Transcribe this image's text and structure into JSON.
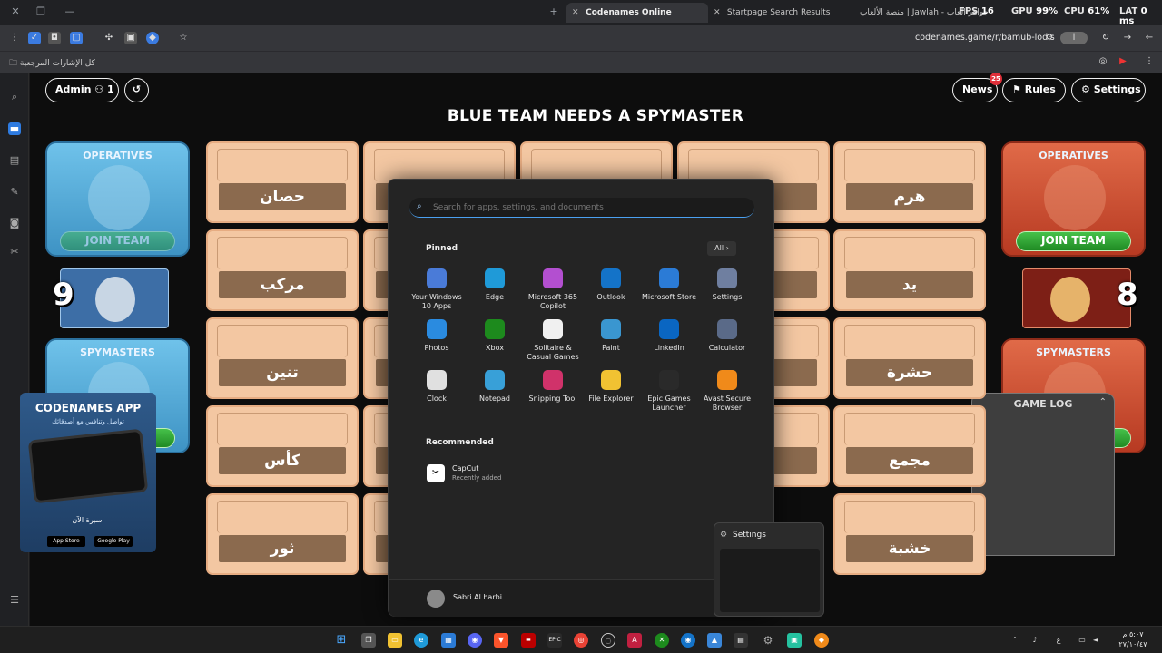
{
  "browser": {
    "tabs": [
      {
        "label": "Codenames Online",
        "active": true
      },
      {
        "label": "Startpage Search Results",
        "active": false
      },
      {
        "label": "جواهر العاب - Jawlah | منصة الألعاب الت...",
        "active": false
      }
    ],
    "perf": {
      "fps_label": "FPS",
      "fps_value": "16",
      "gpu_label": "GPU",
      "gpu_value": "99%",
      "cpu_label": "CPU",
      "cpu_value": "61%",
      "lat_label": "LAT",
      "lat_value": "0 ms"
    },
    "url": "codenames.game/r/bamub-lodis",
    "bookmarks_label": "كل الإشارات المرجعية"
  },
  "game": {
    "admin_label": "Admin",
    "player_count": "1",
    "banner": "BLUE TEAM NEEDS A SPYMASTER",
    "news_label": "News",
    "news_badge": "25",
    "rules_label": "Rules",
    "settings_label": "Settings",
    "blue": {
      "operatives_title": "OPERATIVES",
      "spymasters_title": "SPYMASTERS",
      "join_label": "JOIN TEAM",
      "score": "9"
    },
    "red": {
      "operatives_title": "OPERATIVES",
      "spymasters_title": "SPYMASTERS",
      "join_label": "JOIN TEAM",
      "score": "8"
    },
    "cards_left": [
      "حصان",
      "مركب",
      "تنين",
      "كأس",
      "ثور"
    ],
    "cards_right": [
      "هرم",
      "يد",
      "حشرة",
      "مجمع",
      "خشبة"
    ],
    "game_log_title": "GAME LOG",
    "app_promo": {
      "title": "CODENAMES APP",
      "subtitle": "تواصل وتنافس مع أصدقائك",
      "cta": "اسبرة الآن",
      "store1": "App Store",
      "store2": "Google Play"
    }
  },
  "start_menu": {
    "search_placeholder": "Search for apps, settings, and documents",
    "pinned_title": "Pinned",
    "all_label": "All",
    "pinned": [
      {
        "label": "Your Windows 10 Apps",
        "icon": "windows-apps-icon",
        "color": "#4a7bd8"
      },
      {
        "label": "Edge",
        "icon": "edge-icon",
        "color": "#1f9ad8"
      },
      {
        "label": "Microsoft 365 Copilot",
        "icon": "copilot-icon",
        "color": "#b34fd0"
      },
      {
        "label": "Outlook",
        "icon": "outlook-icon",
        "color": "#1473c8"
      },
      {
        "label": "Microsoft Store",
        "icon": "store-icon",
        "color": "#2b7bd6"
      },
      {
        "label": "Settings",
        "icon": "settings-gear-icon",
        "color": "#6f7fa0"
      },
      {
        "label": "Photos",
        "icon": "photos-icon",
        "color": "#2a8be0"
      },
      {
        "label": "Xbox",
        "icon": "xbox-icon",
        "color": "#1d8a1d"
      },
      {
        "label": "Solitaire & Casual Games",
        "icon": "solitaire-icon",
        "color": "#f0f0f0"
      },
      {
        "label": "Paint",
        "icon": "paint-icon",
        "color": "#3a96d0"
      },
      {
        "label": "LinkedIn",
        "icon": "linkedin-icon",
        "color": "#0a66c2"
      },
      {
        "label": "Calculator",
        "icon": "calculator-icon",
        "color": "#5a6a88"
      },
      {
        "label": "Clock",
        "icon": "clock-icon",
        "color": "#e0e0e0"
      },
      {
        "label": "Notepad",
        "icon": "notepad-icon",
        "color": "#38a0d8"
      },
      {
        "label": "Snipping Tool",
        "icon": "snipping-tool-icon",
        "color": "#d0326a"
      },
      {
        "label": "File Explorer",
        "icon": "file-explorer-icon",
        "color": "#f1c232"
      },
      {
        "label": "Epic Games Launcher",
        "icon": "epic-games-icon",
        "color": "#2a2a2a"
      },
      {
        "label": "Avast Secure Browser",
        "icon": "avast-icon",
        "color": "#f08a1a"
      }
    ],
    "recommended_title": "Recommended",
    "recommended": {
      "name": "CapCut",
      "sub": "Recently added"
    },
    "user_name": "Sabri Al harbi",
    "settings_preview_title": "Settings"
  },
  "taskbar": {
    "time": "٥:٠٧ م",
    "date": "٢٧/١٠/٤٧",
    "lang": "ع"
  }
}
